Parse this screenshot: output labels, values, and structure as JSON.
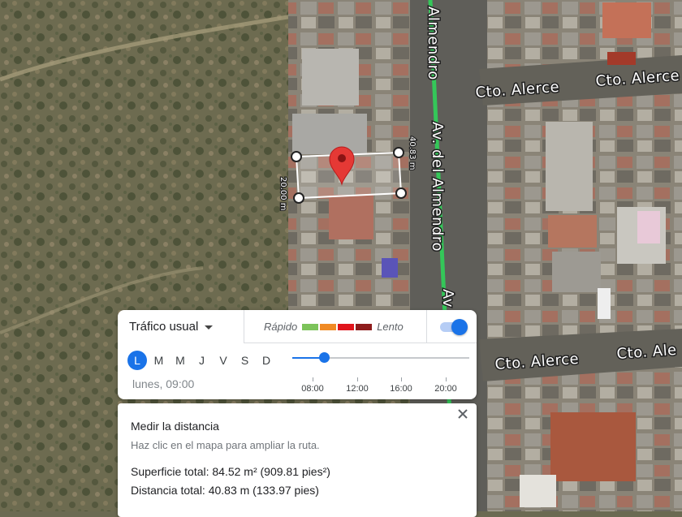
{
  "map": {
    "streets": {
      "almendro_partial": "Almendro",
      "av_del_almendro": "Av. del Almendro",
      "av_partial": "Av",
      "alerce_1": "Cto. Alerce",
      "alerce_2": "Cto. Alerce",
      "alerce_3": "Cto. Alerce",
      "alerce_4": "Cto. Ale"
    },
    "measurement": {
      "side_a": "40.83 m",
      "side_b": "20.00 m"
    },
    "marker": {
      "icon": "map-pin-icon",
      "color": "#e53935"
    }
  },
  "traffic": {
    "selector_label": "Tráfico usual",
    "legend": {
      "fast": "Rápido",
      "slow": "Lento",
      "colors": [
        "#7cc35a",
        "#f08a24",
        "#e0151c",
        "#8e1c1c"
      ]
    },
    "toggle_on": true,
    "days": [
      {
        "label": "L",
        "active": true
      },
      {
        "label": "M",
        "active": false
      },
      {
        "label": "M",
        "active": false
      },
      {
        "label": "J",
        "active": false
      },
      {
        "label": "V",
        "active": false
      },
      {
        "label": "S",
        "active": false
      },
      {
        "label": "D",
        "active": false
      }
    ],
    "selected_time": "lunes, 09:00",
    "slider_value_fraction": 0.18,
    "time_ticks": [
      "08:00",
      "12:00",
      "16:00",
      "20:00"
    ],
    "accent": "#1a73e8"
  },
  "measure": {
    "title": "Medir la distancia",
    "hint": "Haz clic en el mapa para ampliar la ruta.",
    "total_area": "Superficie total: 84.52 m² (909.81 pies²)",
    "total_distance": "Distancia total: 40.83 m (133.97 pies)",
    "close_icon": "close-icon"
  }
}
